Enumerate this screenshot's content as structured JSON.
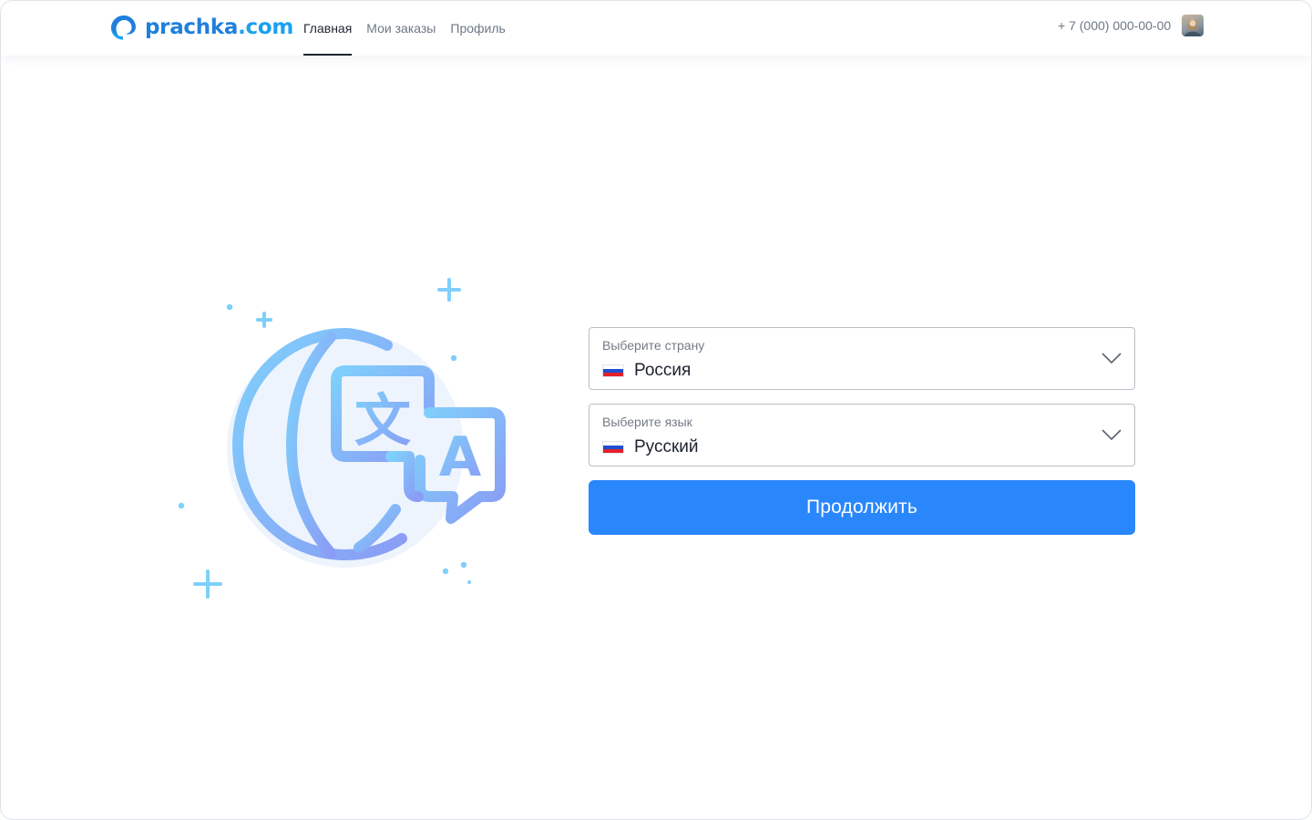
{
  "header": {
    "logo_text": "prachka",
    "logo_domain": ".com",
    "nav": [
      {
        "label": "Главная",
        "active": true
      },
      {
        "label": "Мои заказы",
        "active": false
      },
      {
        "label": "Профиль",
        "active": false
      }
    ],
    "phone": "+ 7 (000) 000-00-00"
  },
  "illustration": {
    "icon": "globe-translate-icon",
    "glyph_cn": "文",
    "glyph_latin": "A"
  },
  "form": {
    "country": {
      "label": "Выберите страну",
      "value": "Россия",
      "flag": "russia-flag-icon"
    },
    "language": {
      "label": "Выберите язык",
      "value": "Русский",
      "flag": "russia-flag-icon"
    },
    "submit_label": "Продолжить"
  },
  "colors": {
    "accent": "#2a87fb",
    "logo": "#1f7fdc",
    "illustration_light": "#7fd0fb",
    "illustration_dark": "#8a9cf5"
  }
}
